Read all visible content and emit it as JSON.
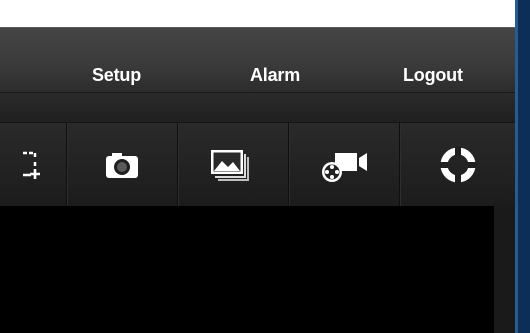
{
  "menu": {
    "items": [
      {
        "label": "Setup"
      },
      {
        "label": "Alarm"
      },
      {
        "label": "Logout"
      }
    ]
  },
  "toolbar": {
    "tools": [
      {
        "icon": "fullscreen-add-icon"
      },
      {
        "icon": "camera-snapshot-icon"
      },
      {
        "icon": "image-gallery-icon"
      },
      {
        "icon": "video-record-icon"
      },
      {
        "icon": "ptz-control-icon"
      }
    ]
  },
  "colors": {
    "accent": "#0b2f57",
    "icon": "#ffffff",
    "background": "#1b1b1b"
  }
}
